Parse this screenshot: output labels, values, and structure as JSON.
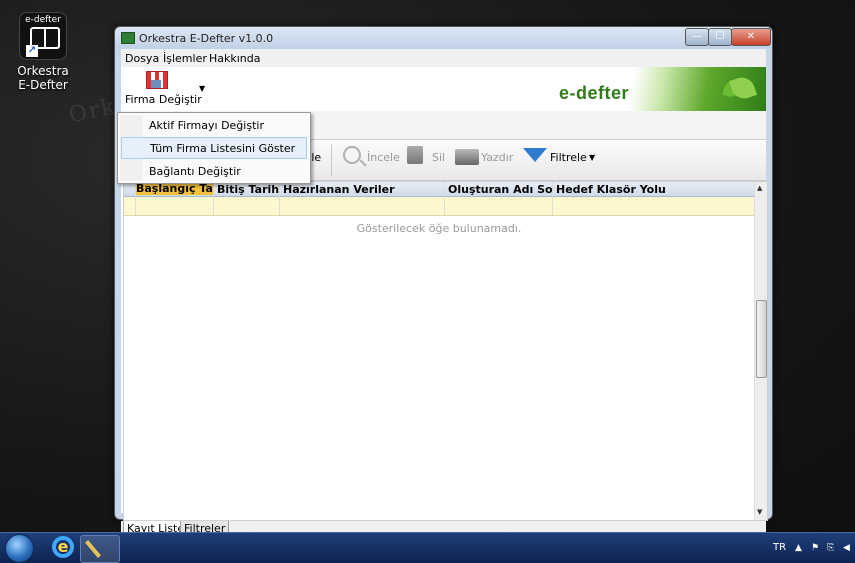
{
  "desktop": {
    "watermark": "Orkestra",
    "icon": {
      "caption_top": "e-defter",
      "label_line1": "Orkestra",
      "label_line2": "E-Defter"
    }
  },
  "window": {
    "title": "Orkestra E-Defter v1.0.0",
    "controls": {
      "minimize": "—",
      "maximize": "☐",
      "close": "✕"
    }
  },
  "menu": {
    "items": [
      "Dosya",
      "İşlemler",
      "Hakkında"
    ]
  },
  "ribbon": {
    "firma_button": "Firma Değiştir",
    "brand": "e-defter"
  },
  "dropdown_menu": {
    "items": [
      "Aktif Firmayı Değiştir",
      "Tüm Firma Listesini Göster",
      "Bağlantı Değiştir"
    ],
    "hovered_index": 1
  },
  "toolbar": {
    "ekle_partial": "kle",
    "incele": "İncele",
    "sil": "Sil",
    "yazdir": "Yazdır",
    "filtrele": "Filtrele"
  },
  "grid": {
    "columns": [
      "Başlangıç Ta...",
      "Bitiş Tarihi",
      "Hazırlanan Veriler",
      "Oluşturan Adı Soyadı",
      "Hedef Klasör Yolu"
    ],
    "empty_message": "Gösterilecek öğe bulunamadı."
  },
  "tabs": [
    "Kayıt Listesi",
    "Filtreler"
  ],
  "taskbar": {
    "language": "TR"
  },
  "colors": {
    "brand_green": "#2f7d18",
    "header_highlight": "#f4c23a",
    "filter_row": "#fdf7d0",
    "taskbar": "#0e2350"
  }
}
